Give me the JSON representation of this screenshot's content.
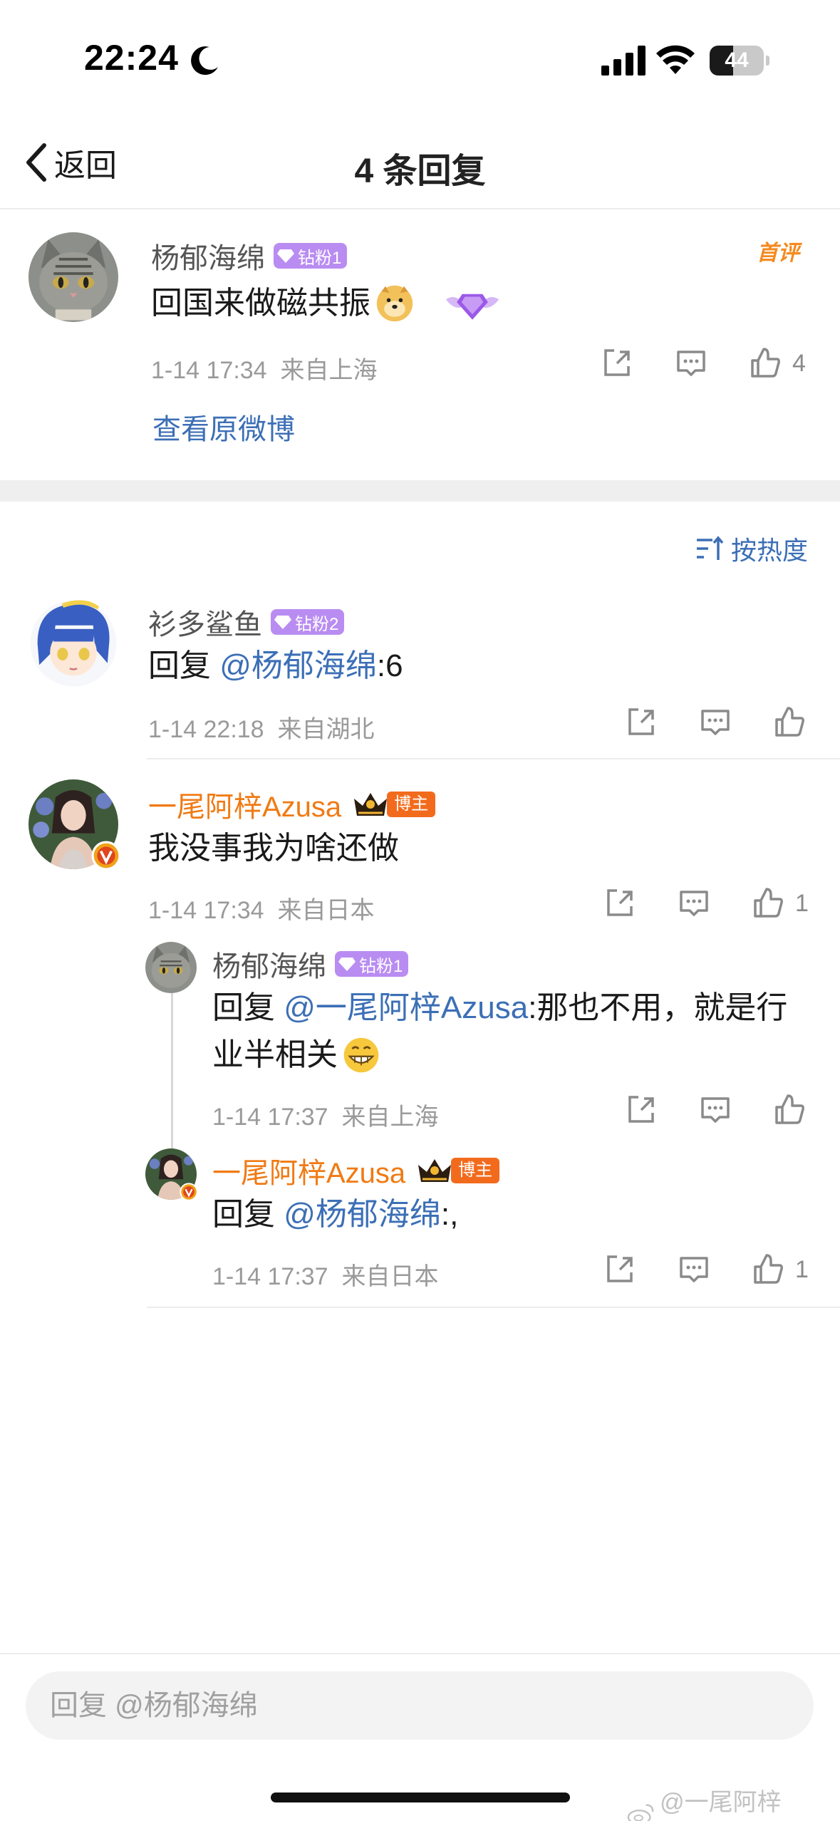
{
  "status_bar": {
    "time": "22:24",
    "battery": "44",
    "battery_level": 0.44
  },
  "nav": {
    "back_label": "返回",
    "title": "4 条回复"
  },
  "main_comment": {
    "user": "杨郁海绵",
    "badge": "钻粉1",
    "text": "回国来做磁共振",
    "first_review": "首评",
    "meta": "1-14 17:34  来自上海",
    "likes": "4",
    "view_original": "查看原微博"
  },
  "sort": {
    "label": "按热度"
  },
  "replies": [
    {
      "user": "衫多鲨鱼",
      "badge": "钻粉2",
      "prefix": "回复 ",
      "mention": "@杨郁海绵",
      "text": ":6",
      "meta": "1-14 22:18  来自湖北",
      "likes": ""
    },
    {
      "user": "一尾阿梓Azusa",
      "role": "博主",
      "text": "我没事我为啥还做",
      "meta": "1-14 17:34  来自日本",
      "likes": "1",
      "sub_replies": [
        {
          "user": "杨郁海绵",
          "badge": "钻粉1",
          "prefix": "回复 ",
          "mention": "@一尾阿梓Azusa",
          "text_line1": ":那也不用，就是行",
          "text_line2": "业半相关",
          "meta": "1-14 17:37  来自上海",
          "likes": ""
        },
        {
          "user": "一尾阿梓Azusa",
          "role": "博主",
          "prefix": "回复 ",
          "mention": "@杨郁海绵",
          "text": ":,",
          "meta": "1-14 17:37  来自日本",
          "likes": "1"
        }
      ]
    }
  ],
  "reply_box": {
    "placeholder": "回复 @杨郁海绵"
  },
  "watermark": "@一尾阿梓Azusa",
  "icons": [
    "moon-icon",
    "signal-icon",
    "wifi-icon",
    "battery-icon",
    "back-chevron-icon",
    "gem-icon",
    "share-icon",
    "comment-icon",
    "like-icon",
    "sort-icon",
    "crown-icon",
    "verified-icon",
    "doge-emoji",
    "grin-emoji",
    "weibo-logo-icon"
  ],
  "colors": {
    "link": "#3c6fb6",
    "vip_name": "#f07a14",
    "badge": "#b98cf2",
    "bozhu": "#f26b1d"
  }
}
